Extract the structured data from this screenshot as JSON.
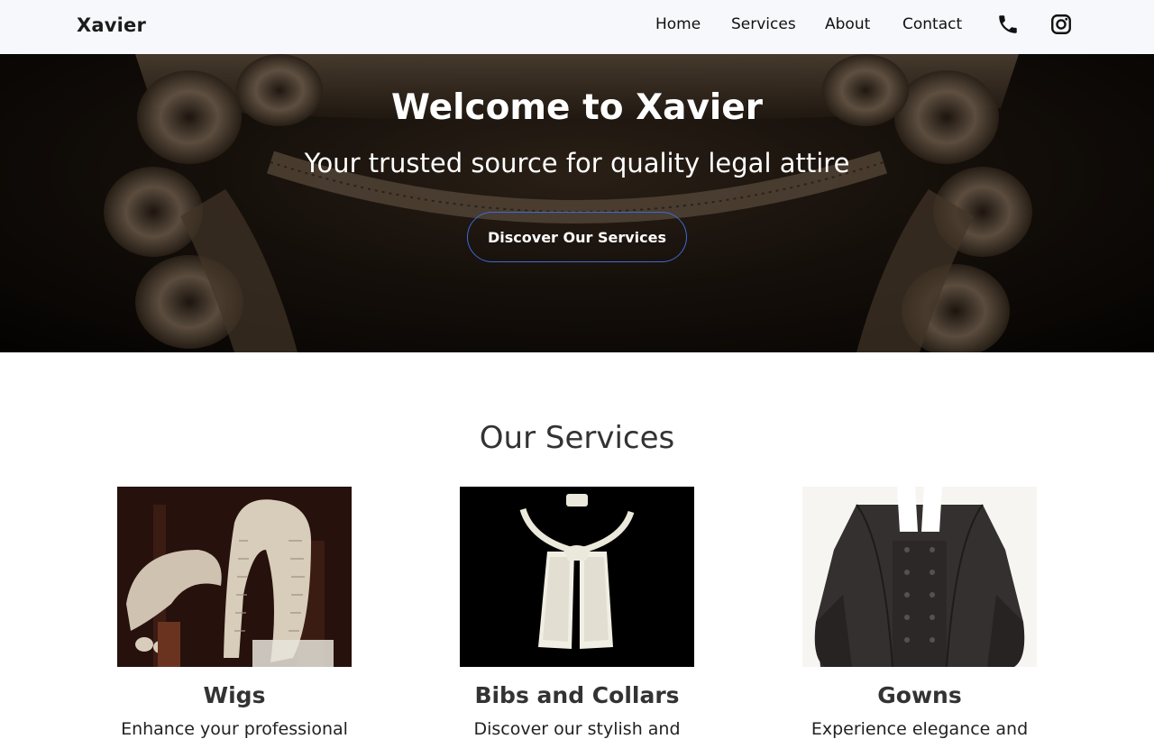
{
  "nav": {
    "brand": "Xavier",
    "links": [
      {
        "label": "Home"
      },
      {
        "label": "Services"
      },
      {
        "label": "About"
      },
      {
        "label": "Contact"
      }
    ],
    "icons": [
      "phone-icon",
      "instagram-icon"
    ]
  },
  "hero": {
    "title": "Welcome to Xavier",
    "subtitle": "Your trusted source for quality legal attire",
    "button_label": "Discover Our Services"
  },
  "services": {
    "heading": "Our Services",
    "items": [
      {
        "title": "Wigs",
        "description": "Enhance your professional"
      },
      {
        "title": "Bibs and Collars",
        "description": "Discover our stylish and"
      },
      {
        "title": "Gowns",
        "description": "Experience elegance and"
      }
    ]
  },
  "colors": {
    "navbar_bg": "#f6f8fb",
    "button_border": "#3b6bd6",
    "heading_text": "#333333"
  }
}
